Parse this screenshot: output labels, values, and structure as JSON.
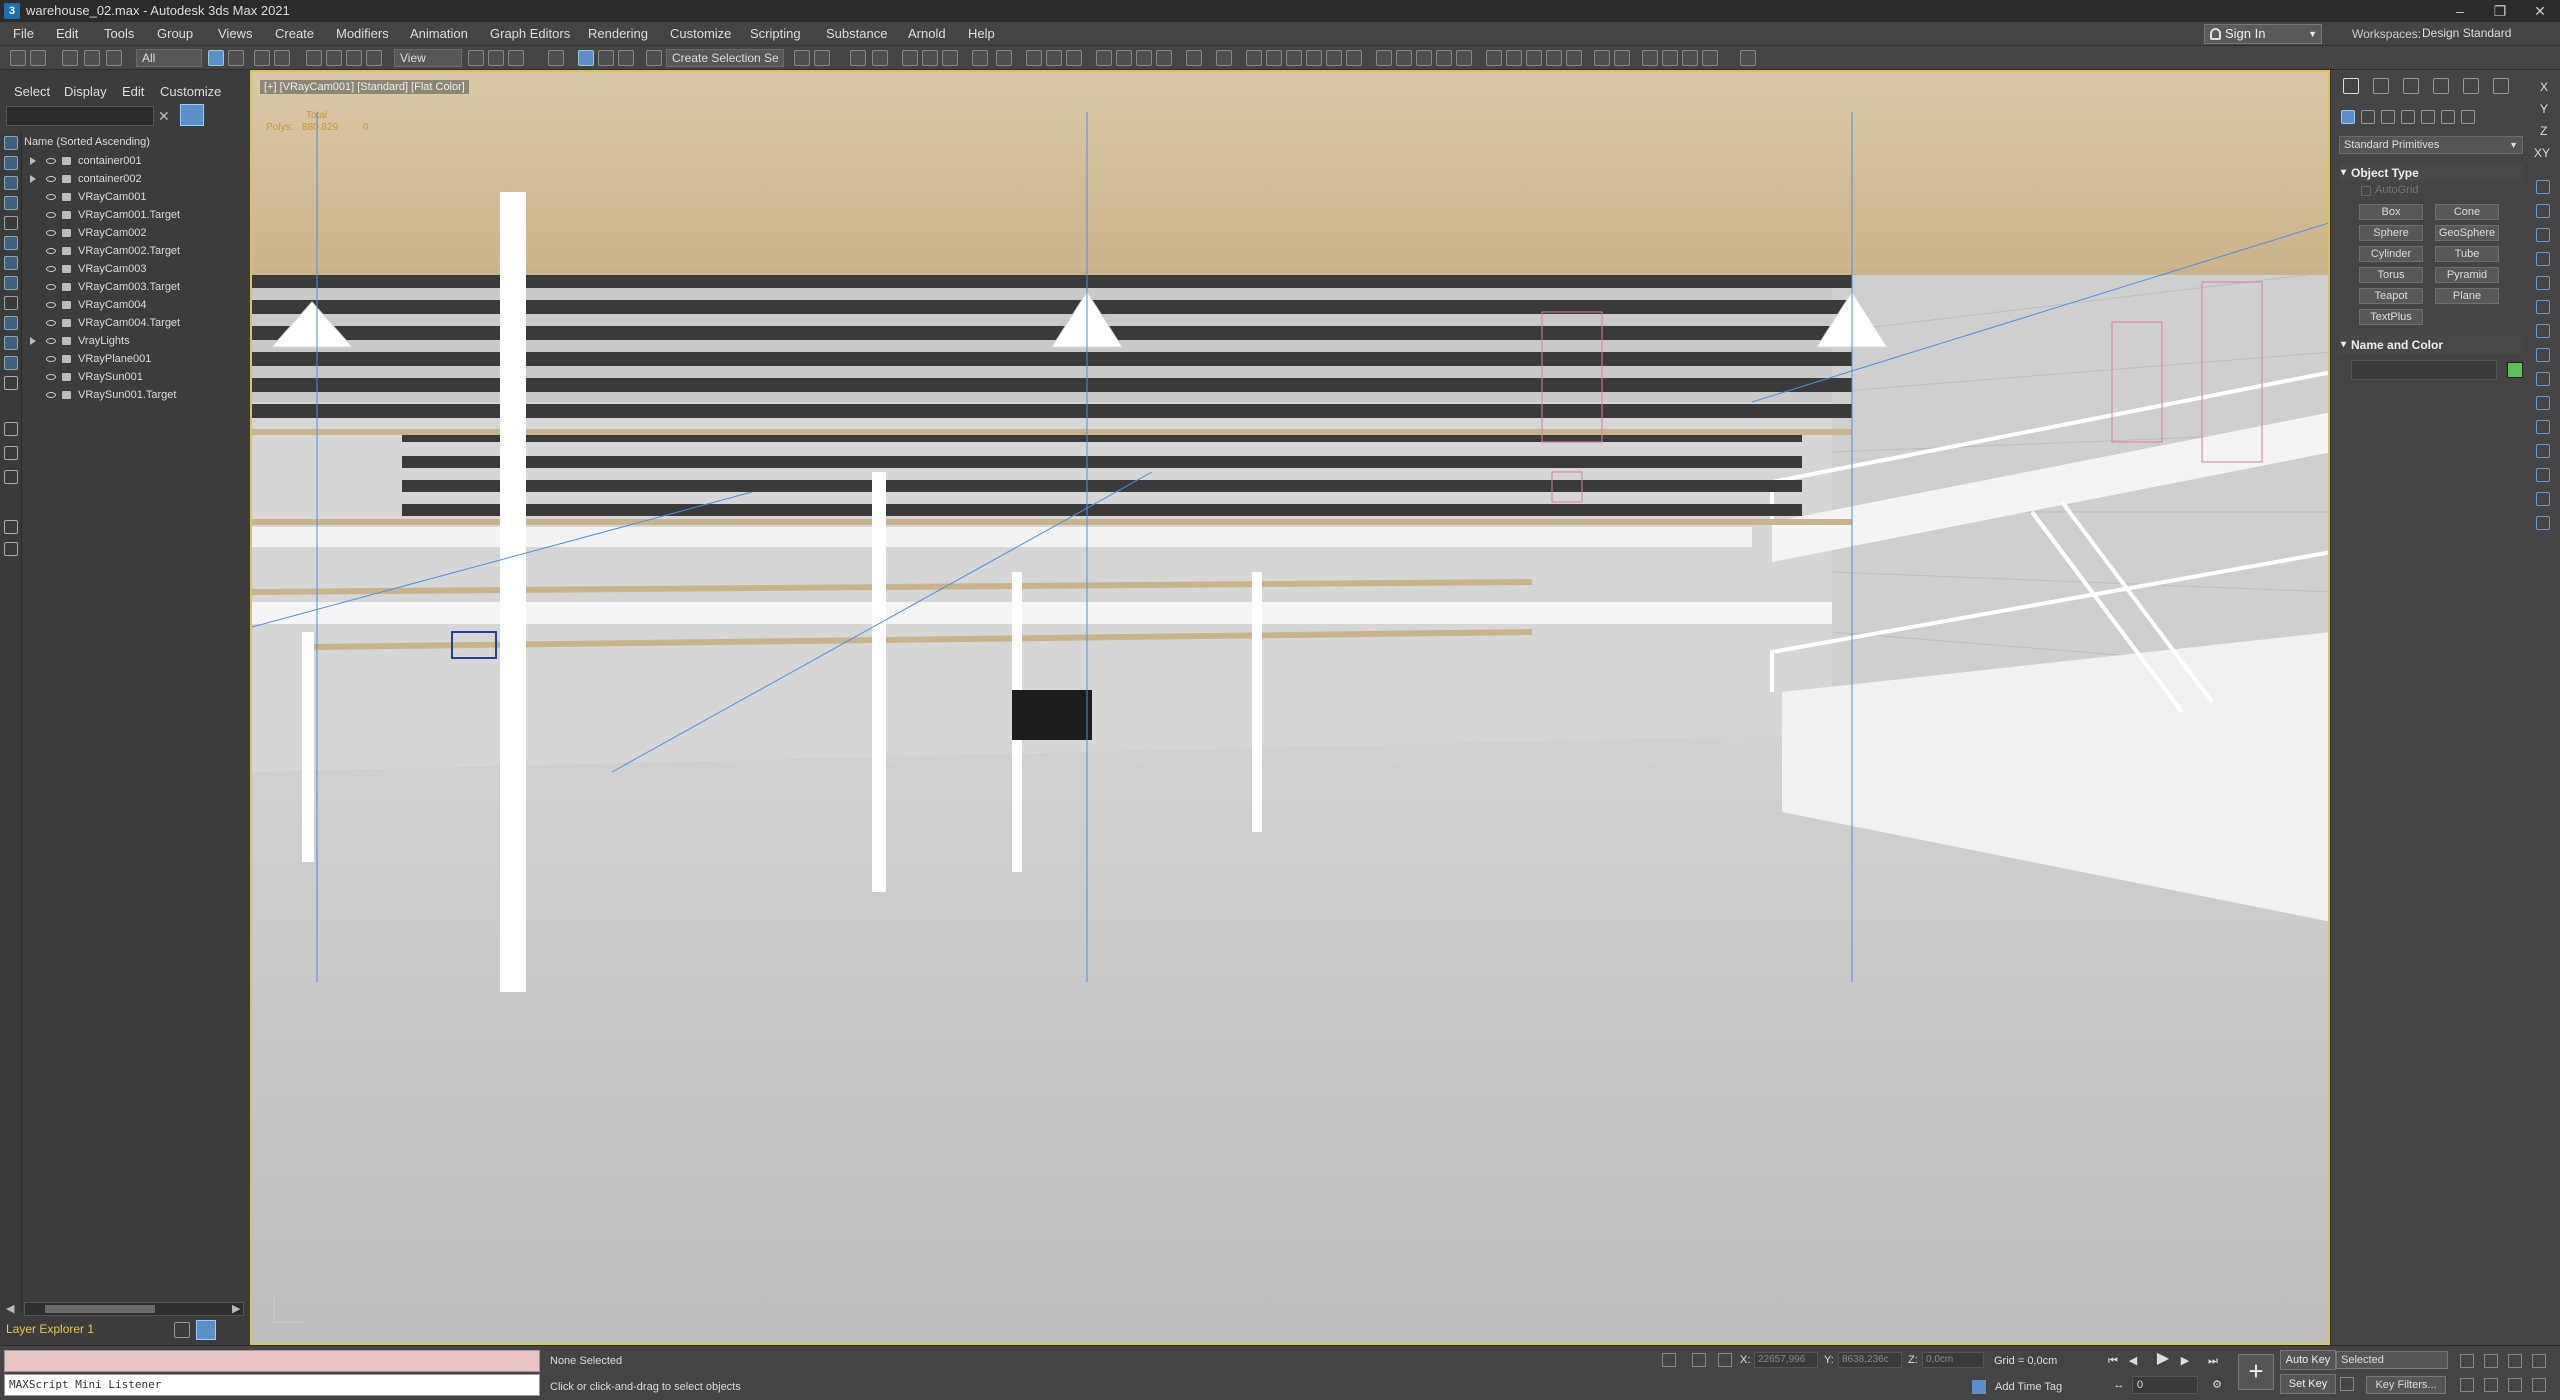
{
  "window": {
    "title": "warehouse_02.max - Autodesk 3ds Max 2021",
    "app_icon": "3"
  },
  "menu": [
    "File",
    "Edit",
    "Tools",
    "Group",
    "Views",
    "Create",
    "Modifiers",
    "Animation",
    "Graph Editors",
    "Rendering",
    "Customize",
    "Scripting",
    "Substance",
    "Arnold",
    "Help"
  ],
  "account": {
    "sign_in": "Sign In"
  },
  "workspaces": {
    "label": "Workspaces:",
    "value": "Design Standard"
  },
  "toolbar": {
    "filter_value": "All",
    "refcoord_value": "View",
    "selection_set": "Create Selection Se"
  },
  "scene_explorer": {
    "tabs": [
      "Select",
      "Display",
      "Edit",
      "Customize"
    ],
    "column_header": "Name (Sorted Ascending)",
    "items": [
      {
        "name": "container001",
        "expandable": true
      },
      {
        "name": "container002",
        "expandable": true
      },
      {
        "name": "VRayCam001",
        "expandable": false
      },
      {
        "name": "VRayCam001.Target",
        "expandable": false
      },
      {
        "name": "VRayCam002",
        "expandable": false
      },
      {
        "name": "VRayCam002.Target",
        "expandable": false
      },
      {
        "name": "VRayCam003",
        "expandable": false
      },
      {
        "name": "VRayCam003.Target",
        "expandable": false
      },
      {
        "name": "VRayCam004",
        "expandable": false
      },
      {
        "name": "VRayCam004.Target",
        "expandable": false
      },
      {
        "name": "VrayLights",
        "expandable": true
      },
      {
        "name": "VRayPlane001",
        "expandable": false
      },
      {
        "name": "VRaySun001",
        "expandable": false
      },
      {
        "name": "VRaySun001.Target",
        "expandable": false
      }
    ],
    "layer_explorer": "Layer Explorer 1"
  },
  "viewport": {
    "label": "[+] [VRayCam001] [Standard] [Flat Color]",
    "stats_total_label": "Total",
    "stats_polys_label": "Polys:",
    "stats_polys_value": "880.829",
    "stats_polys_sel": "0"
  },
  "command_panel": {
    "category": "Standard Primitives",
    "object_type_title": "Object Type",
    "autogrid": "AutoGrid",
    "buttons": [
      "Box",
      "Cone",
      "Sphere",
      "GeoSphere",
      "Cylinder",
      "Tube",
      "Torus",
      "Pyramid",
      "Teapot",
      "Plane",
      "TextPlus"
    ],
    "name_color_title": "Name and Color",
    "object_color": "#5ec25a"
  },
  "axis_labels": [
    "X",
    "Y",
    "Z",
    "XY"
  ],
  "status": {
    "listener_placeholder": "MAXScript Mini Listener",
    "selection": "None Selected",
    "prompt": "Click or click-and-drag to select objects",
    "x_label": "X:",
    "x_value": "22657,996",
    "y_label": "Y:",
    "y_value": "8638,236c",
    "z_label": "Z:",
    "z_value": "0,0cm",
    "grid": "Grid = 0,0cm",
    "add_time_tag": "Add Time Tag",
    "auto_key": "Auto Key",
    "set_key": "Set Key",
    "key_mode": "Selected",
    "key_filters": "Key Filters...",
    "frame": "0"
  }
}
